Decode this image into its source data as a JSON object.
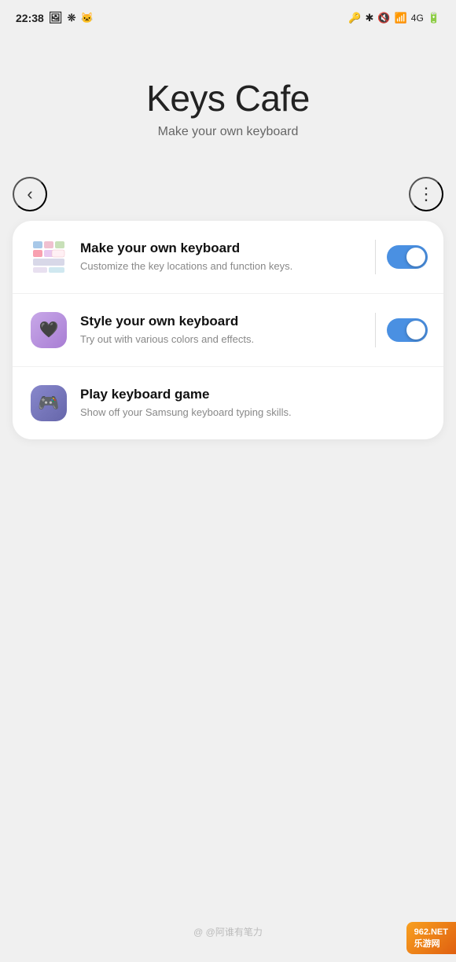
{
  "statusBar": {
    "time": "22:38",
    "leftIcons": [
      "🖼",
      "❊",
      "🐧"
    ],
    "rightIcons": [
      "🔑",
      "✱",
      "🔇",
      "📶",
      "4G",
      "🔋"
    ]
  },
  "header": {
    "title": "Keys Cafe",
    "subtitle": "Make your own keyboard"
  },
  "nav": {
    "backLabel": "‹",
    "moreLabel": "⋮"
  },
  "menuItems": [
    {
      "id": "make-keyboard",
      "title": "Make your own keyboard",
      "description": "Customize the key locations and function keys.",
      "hasToggle": true,
      "toggleOn": true,
      "iconType": "keyboard"
    },
    {
      "id": "style-keyboard",
      "title": "Style your own keyboard",
      "description": "Try out with various colors and effects.",
      "hasToggle": true,
      "toggleOn": true,
      "iconType": "style"
    },
    {
      "id": "play-game",
      "title": "Play keyboard game",
      "description": "Show off your Samsung keyboard typing skills.",
      "hasToggle": false,
      "toggleOn": false,
      "iconType": "game"
    }
  ],
  "watermark": {
    "text": "@ @阿谁有笔力"
  },
  "badge": {
    "line1": "962.NET",
    "line2": "乐游网"
  }
}
